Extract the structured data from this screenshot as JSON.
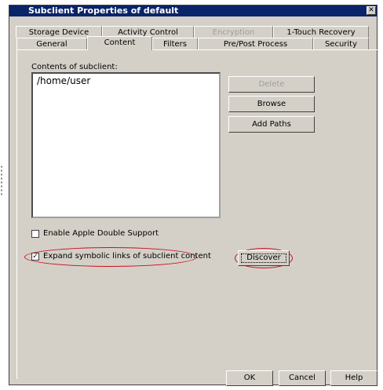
{
  "window": {
    "title": "Subclient Properties of default",
    "close_glyph": "✕"
  },
  "tabs_row1": [
    {
      "label": "Storage Device",
      "state": "normal"
    },
    {
      "label": "Activity Control",
      "state": "normal"
    },
    {
      "label": "Encryption",
      "state": "disabled"
    },
    {
      "label": "1-Touch Recovery",
      "state": "normal"
    }
  ],
  "tabs_row2": [
    {
      "label": "General",
      "state": "normal"
    },
    {
      "label": "Content",
      "state": "active"
    },
    {
      "label": "Filters",
      "state": "normal"
    },
    {
      "label": "Pre/Post Process",
      "state": "normal"
    },
    {
      "label": "Security",
      "state": "normal"
    }
  ],
  "content": {
    "contents_label": "Contents of subclient:",
    "items": [
      "/home/user"
    ],
    "delete_label": "Delete",
    "browse_label": "Browse",
    "add_paths_label": "Add Paths",
    "apple_double_label": "Enable Apple Double Support",
    "apple_double_checked": false,
    "symlinks_label": "Expand symbolic links of subclient content",
    "symlinks_checked": true,
    "discover_label": "Discover"
  },
  "footer": {
    "ok_label": "OK",
    "cancel_label": "Cancel",
    "help_label": "Help"
  },
  "colors": {
    "highlight_oval": "#c8101e",
    "titlebar": "#0a246a",
    "dialog_bg": "#d4d0c8"
  }
}
